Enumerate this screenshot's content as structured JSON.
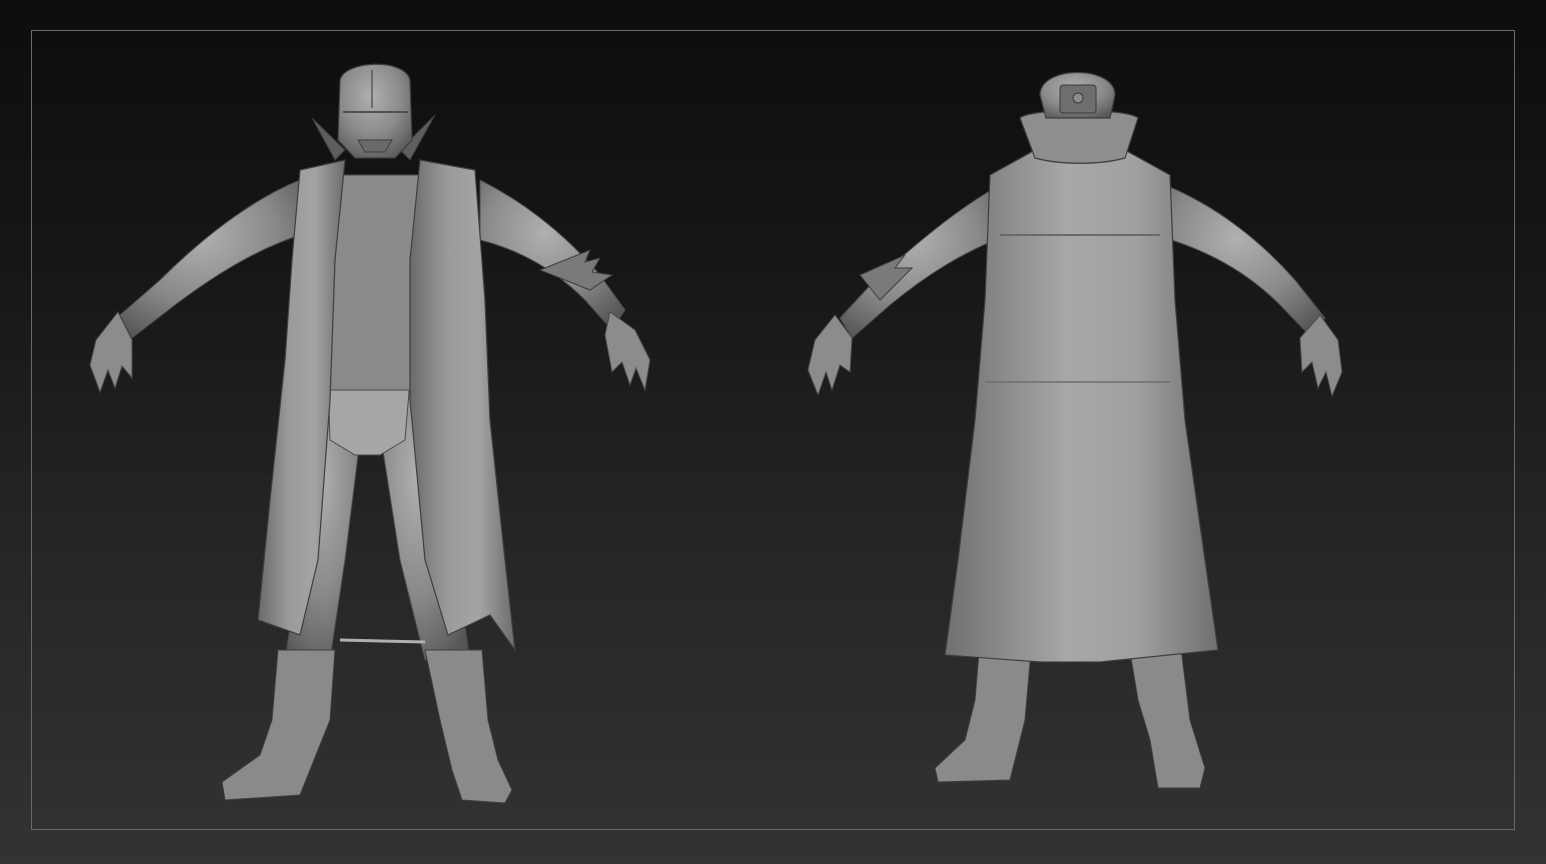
{
  "scene": {
    "background": "dark-gradient",
    "accent_colors": {
      "bg_top": "#0d0d0d",
      "bg_bottom": "#333333",
      "frame": "#6a6a6a",
      "clay": "#8e8e8e",
      "clay_dark": "#5a5a5a",
      "clay_light": "#b4b4b4"
    },
    "figures": [
      {
        "view": "front",
        "icon": "character-front-view"
      },
      {
        "view": "back",
        "icon": "character-back-view"
      }
    ]
  }
}
